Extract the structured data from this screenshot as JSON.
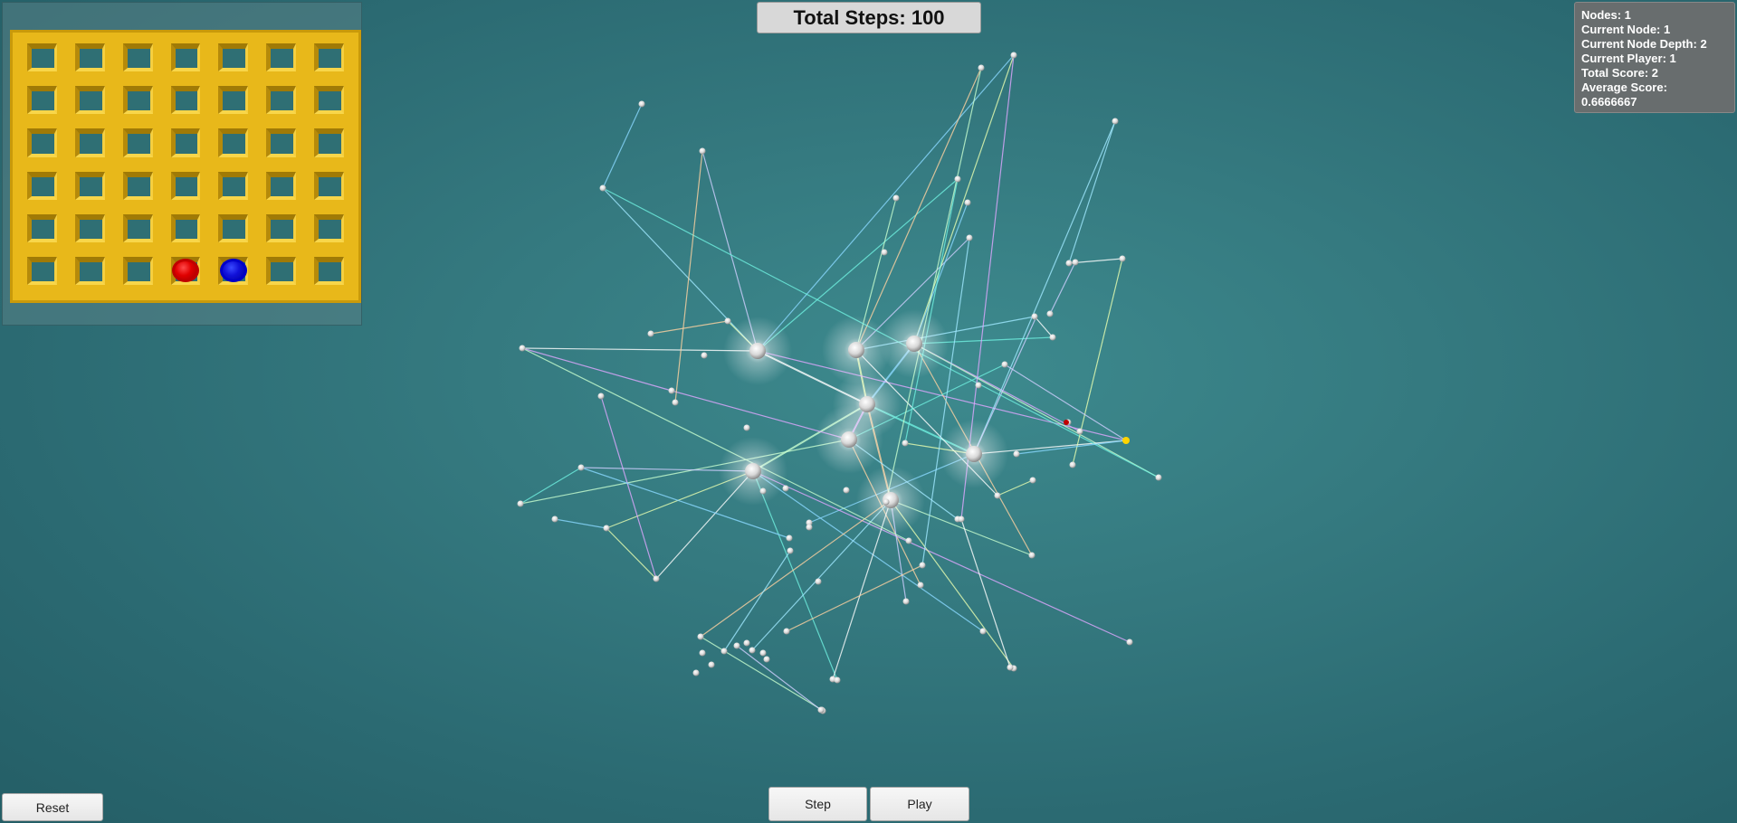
{
  "header": {
    "total_steps": "Total Steps: 100"
  },
  "stats": {
    "nodes": "Nodes: 1",
    "current_node": "Current Node: 1",
    "current_node_depth": "Current Node Depth: 2",
    "current_player": "Current Player: 1",
    "total_score": "Total Score: 2",
    "average_score_label": "Average Score:",
    "average_score_value": "0.6666667"
  },
  "board": {
    "columns": 7,
    "rows": 6,
    "pieces": [
      {
        "row": 6,
        "col": 4,
        "color": "red"
      },
      {
        "row": 6,
        "col": 5,
        "color": "blue"
      }
    ],
    "frame_color": "#e8b81a",
    "red_color": "#e00000",
    "blue_color": "#1010d8"
  },
  "controls": {
    "reset_label": "Reset",
    "step_label": "Step",
    "play_label": "Play"
  },
  "scene": {
    "description_icon": "tree-graph-visualization",
    "background_color": "#357a80"
  }
}
